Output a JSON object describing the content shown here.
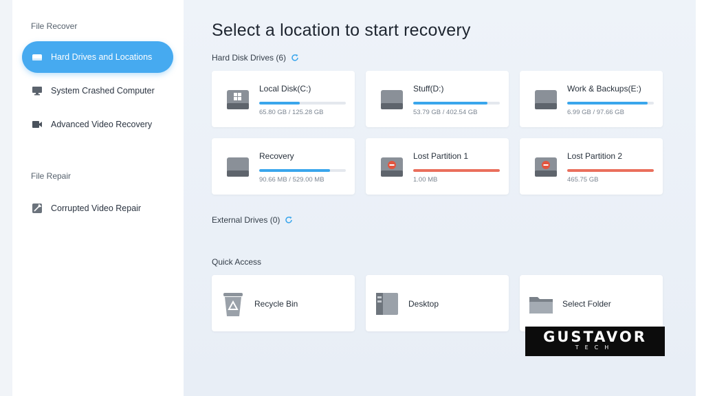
{
  "sidebar": {
    "section_recover": "File Recover",
    "section_repair": "File Repair",
    "items": [
      {
        "label": "Hard Drives and Locations",
        "active": true
      },
      {
        "label": "System Crashed Computer"
      },
      {
        "label": "Advanced Video Recovery"
      },
      {
        "label": "Corrupted Video Repair"
      }
    ]
  },
  "main": {
    "title": "Select a location to start recovery",
    "hard_disk_label": "Hard Disk Drives (6)",
    "external_label": "External Drives (0)",
    "quick_access_label": "Quick Access",
    "drives": [
      {
        "name": "Local Disk(C:)",
        "size": "65.80 GB / 125.28 GB",
        "usage": 0.47,
        "status": "ok",
        "windows": true
      },
      {
        "name": "Stuff(D:)",
        "size": "53.79 GB / 402.54 GB",
        "usage": 0.86,
        "status": "ok"
      },
      {
        "name": "Work & Backups(E:)",
        "size": "6.99 GB / 97.66 GB",
        "usage": 0.93,
        "status": "ok"
      },
      {
        "name": "Recovery",
        "size": "90.66 MB / 529.00 MB",
        "usage": 0.82,
        "status": "ok"
      },
      {
        "name": "Lost Partition 1",
        "size": "1.00 MB",
        "usage": 1.0,
        "status": "lost"
      },
      {
        "name": "Lost Partition 2",
        "size": "465.75 GB",
        "usage": 1.0,
        "status": "lost"
      }
    ],
    "quick_access": [
      {
        "label": "Recycle Bin",
        "icon": "recycle-bin-icon"
      },
      {
        "label": "Desktop",
        "icon": "desktop-icon"
      },
      {
        "label": "Select Folder",
        "icon": "folder-icon"
      }
    ]
  },
  "watermark": {
    "title": "GUSTAVOR",
    "subtitle": "TECH"
  },
  "colors": {
    "accent": "#46aaf0",
    "bar": "#3aa6ec",
    "lost": "#ea6f5c"
  }
}
